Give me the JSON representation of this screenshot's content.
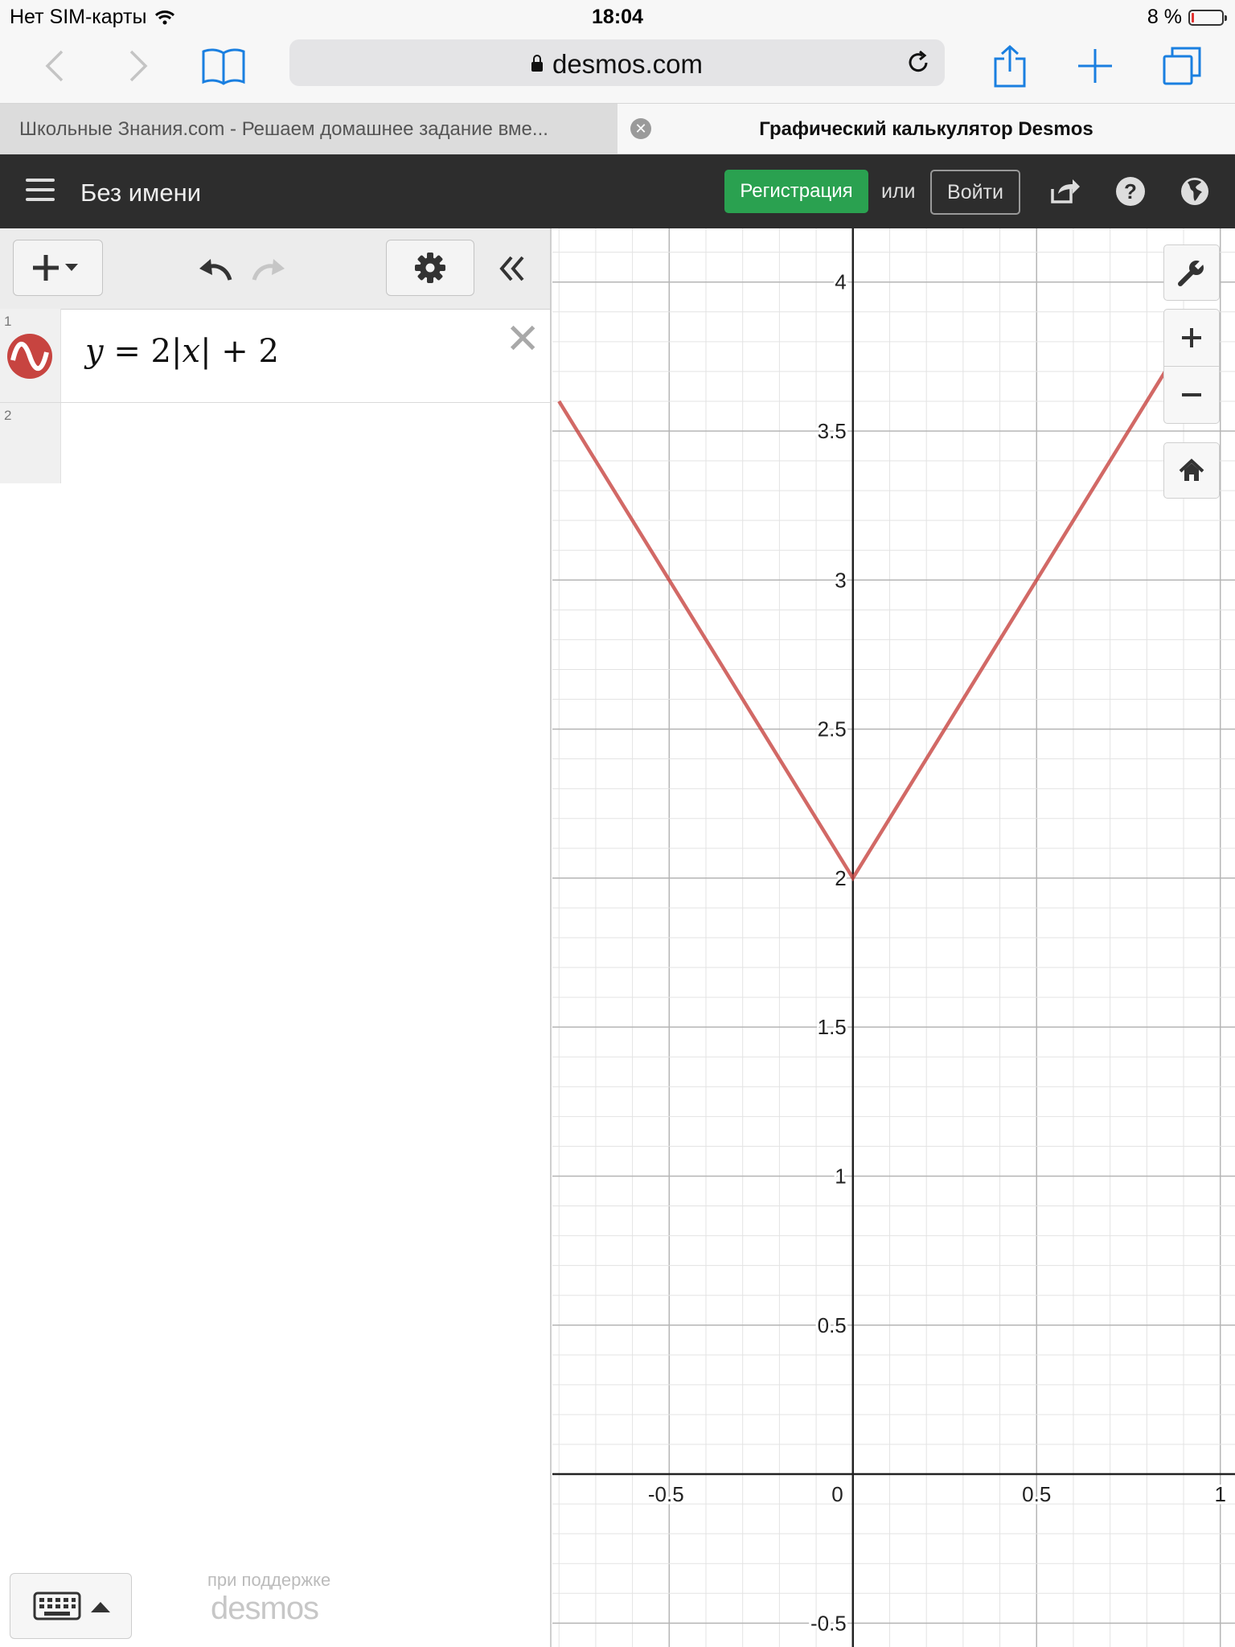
{
  "status_bar": {
    "carrier": "Нет SIM-карты",
    "time": "18:04",
    "battery": "8 %",
    "battery_level_percent": 8
  },
  "browser": {
    "url": "desmos.com",
    "tabs": [
      {
        "title": "Школьные Знания.com - Решаем домашнее задание вме...",
        "active": false
      },
      {
        "title": "Графический калькулятор Desmos",
        "active": true
      }
    ]
  },
  "header": {
    "title": "Без имени",
    "register_label": "Регистрация",
    "or_label": "или",
    "login_label": "Войти"
  },
  "expressions": [
    {
      "number": "1",
      "latex_parts": [
        "y",
        " = 2",
        "|",
        "x",
        "|",
        " + 2"
      ],
      "color": "#c74440"
    },
    {
      "number": "2"
    }
  ],
  "footer": {
    "powered_by": "при поддержке",
    "logo_text": "desmos"
  },
  "colors": {
    "accent_green": "#2aa150",
    "header_bg": "#2d2d2d",
    "curve": "#c74440"
  },
  "chart_data": {
    "type": "line",
    "series": [
      {
        "values": [
          [
            -0.8,
            3.6
          ],
          [
            0,
            2
          ],
          [
            0.9,
            3.8
          ]
        ]
      }
    ],
    "function": "y = 2|x| + 2",
    "xlim": [
      -0.818,
      1.04
    ],
    "ylim": [
      -0.58,
      4.18
    ],
    "x_ticks": [
      -0.5,
      0,
      0.5,
      1
    ],
    "x_tick_labels": [
      "-0.5",
      "0",
      "0.5",
      "1"
    ],
    "y_ticks": [
      -0.5,
      0.5,
      1,
      1.5,
      2,
      2.5,
      3,
      3.5,
      4
    ],
    "y_tick_labels": [
      "-0.5",
      "0.5",
      "1",
      "1.5",
      "2",
      "2.5",
      "3",
      "3.5",
      "4"
    ],
    "grid": true,
    "minor_grid_step": 0.1
  }
}
